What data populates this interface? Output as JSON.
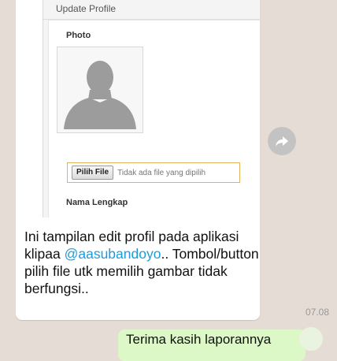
{
  "screenshot": {
    "panel_title": "Update Profile",
    "photo_label": "Photo",
    "file_button_label": "Pilih File",
    "file_status": "Tidak ada file yang dipilih",
    "name_label": "Nama Lengkap"
  },
  "message": {
    "text_before": "Ini tampilan edit profil pada aplikasi klipaa ",
    "mention": "@aasubandoyo",
    "text_after": ".. Tombol/button pilih file utk memilih gambar tidak berfungsi..",
    "time": "07.08"
  },
  "outgoing": {
    "text": "Terima kasih laporannya"
  },
  "icons": {
    "share": "share-forward-icon",
    "avatar": "avatar-placeholder-icon"
  },
  "colors": {
    "chat_background": "#e5ddd5",
    "outgoing_bubble": "#dcf8c6",
    "mention": "#1d9bd8",
    "file_box_border": "#e0b25a"
  }
}
